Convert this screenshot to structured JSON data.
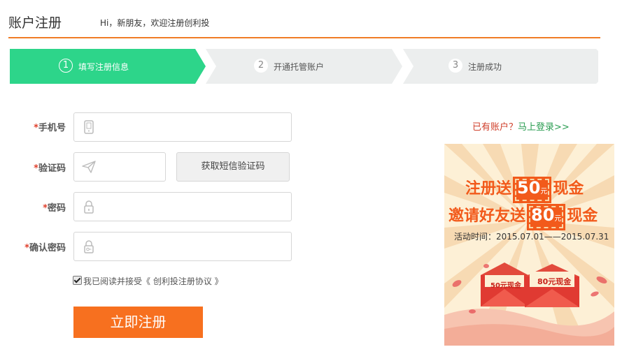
{
  "header": {
    "title": "账户注册",
    "welcome": "Hi，新朋友，欢迎注册创利投",
    "accent_color": "#f07c25"
  },
  "steps": [
    {
      "number": "1",
      "label": "填写注册信息",
      "active": true
    },
    {
      "number": "2",
      "label": "开通托管账户",
      "active": false
    },
    {
      "number": "3",
      "label": "注册成功",
      "active": false
    }
  ],
  "form": {
    "required_mark": "*",
    "phone": {
      "label": "手机号",
      "value": "",
      "icon": "phone-icon"
    },
    "code": {
      "label": "验证码",
      "value": "",
      "icon": "paper-plane-icon"
    },
    "sms_button": "获取短信验证码",
    "password": {
      "label": "密码",
      "value": "",
      "icon": "lock-icon"
    },
    "confirm_password": {
      "label": "确认密码",
      "value": "",
      "icon": "key-lock-icon"
    },
    "agree_checked": true,
    "agree_text": "我已阅读并接受",
    "agreement_link": "《 创利投注册协议 》",
    "submit": "立即注册"
  },
  "login": {
    "question": "已有账户？",
    "link": "马上登录>>"
  },
  "promo": {
    "line1_prefix": "注册送",
    "line1_amount": "50",
    "line1_unit": "元",
    "line1_suffix": "现金",
    "line2_prefix": "邀请好友送",
    "line2_amount": "80",
    "line2_unit": "元",
    "line2_suffix": "现金",
    "date": "活动时间：2015.07.01——2015.07.31",
    "envelope1": "50元现金",
    "envelope2": "80元现金"
  },
  "colors": {
    "step_active": "#2dd58a",
    "step_inactive": "#eceeee",
    "submit": "#f7701f",
    "promo_orange": "#f25a1b"
  }
}
